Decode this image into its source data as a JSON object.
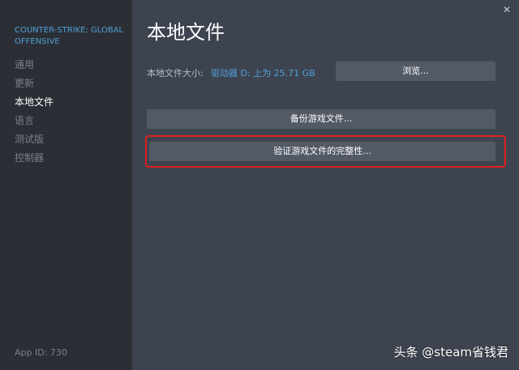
{
  "sidebar": {
    "game_title": "COUNTER-STRIKE: GLOBAL OFFENSIVE",
    "items": [
      {
        "label": "通用"
      },
      {
        "label": "更新"
      },
      {
        "label": "本地文件"
      },
      {
        "label": "语言"
      },
      {
        "label": "测试版"
      },
      {
        "label": "控制器"
      }
    ],
    "active_index": 2,
    "app_id": "App ID: 730"
  },
  "main": {
    "title": "本地文件",
    "size_label": "本地文件大小:",
    "size_value": "驱动器 D: 上为 25.71 GB",
    "browse_label": "浏览...",
    "backup_label": "备份游戏文件...",
    "verify_label": "验证游戏文件的完整性..."
  },
  "window": {
    "close_glyph": "✕"
  },
  "watermark": "头条 @steam省钱君",
  "colors": {
    "sidebar_bg": "#2b2f35",
    "main_bg": "#3d4450",
    "accent": "#4f9ed8",
    "button_bg": "#535a66",
    "highlight": "#e0201f"
  }
}
